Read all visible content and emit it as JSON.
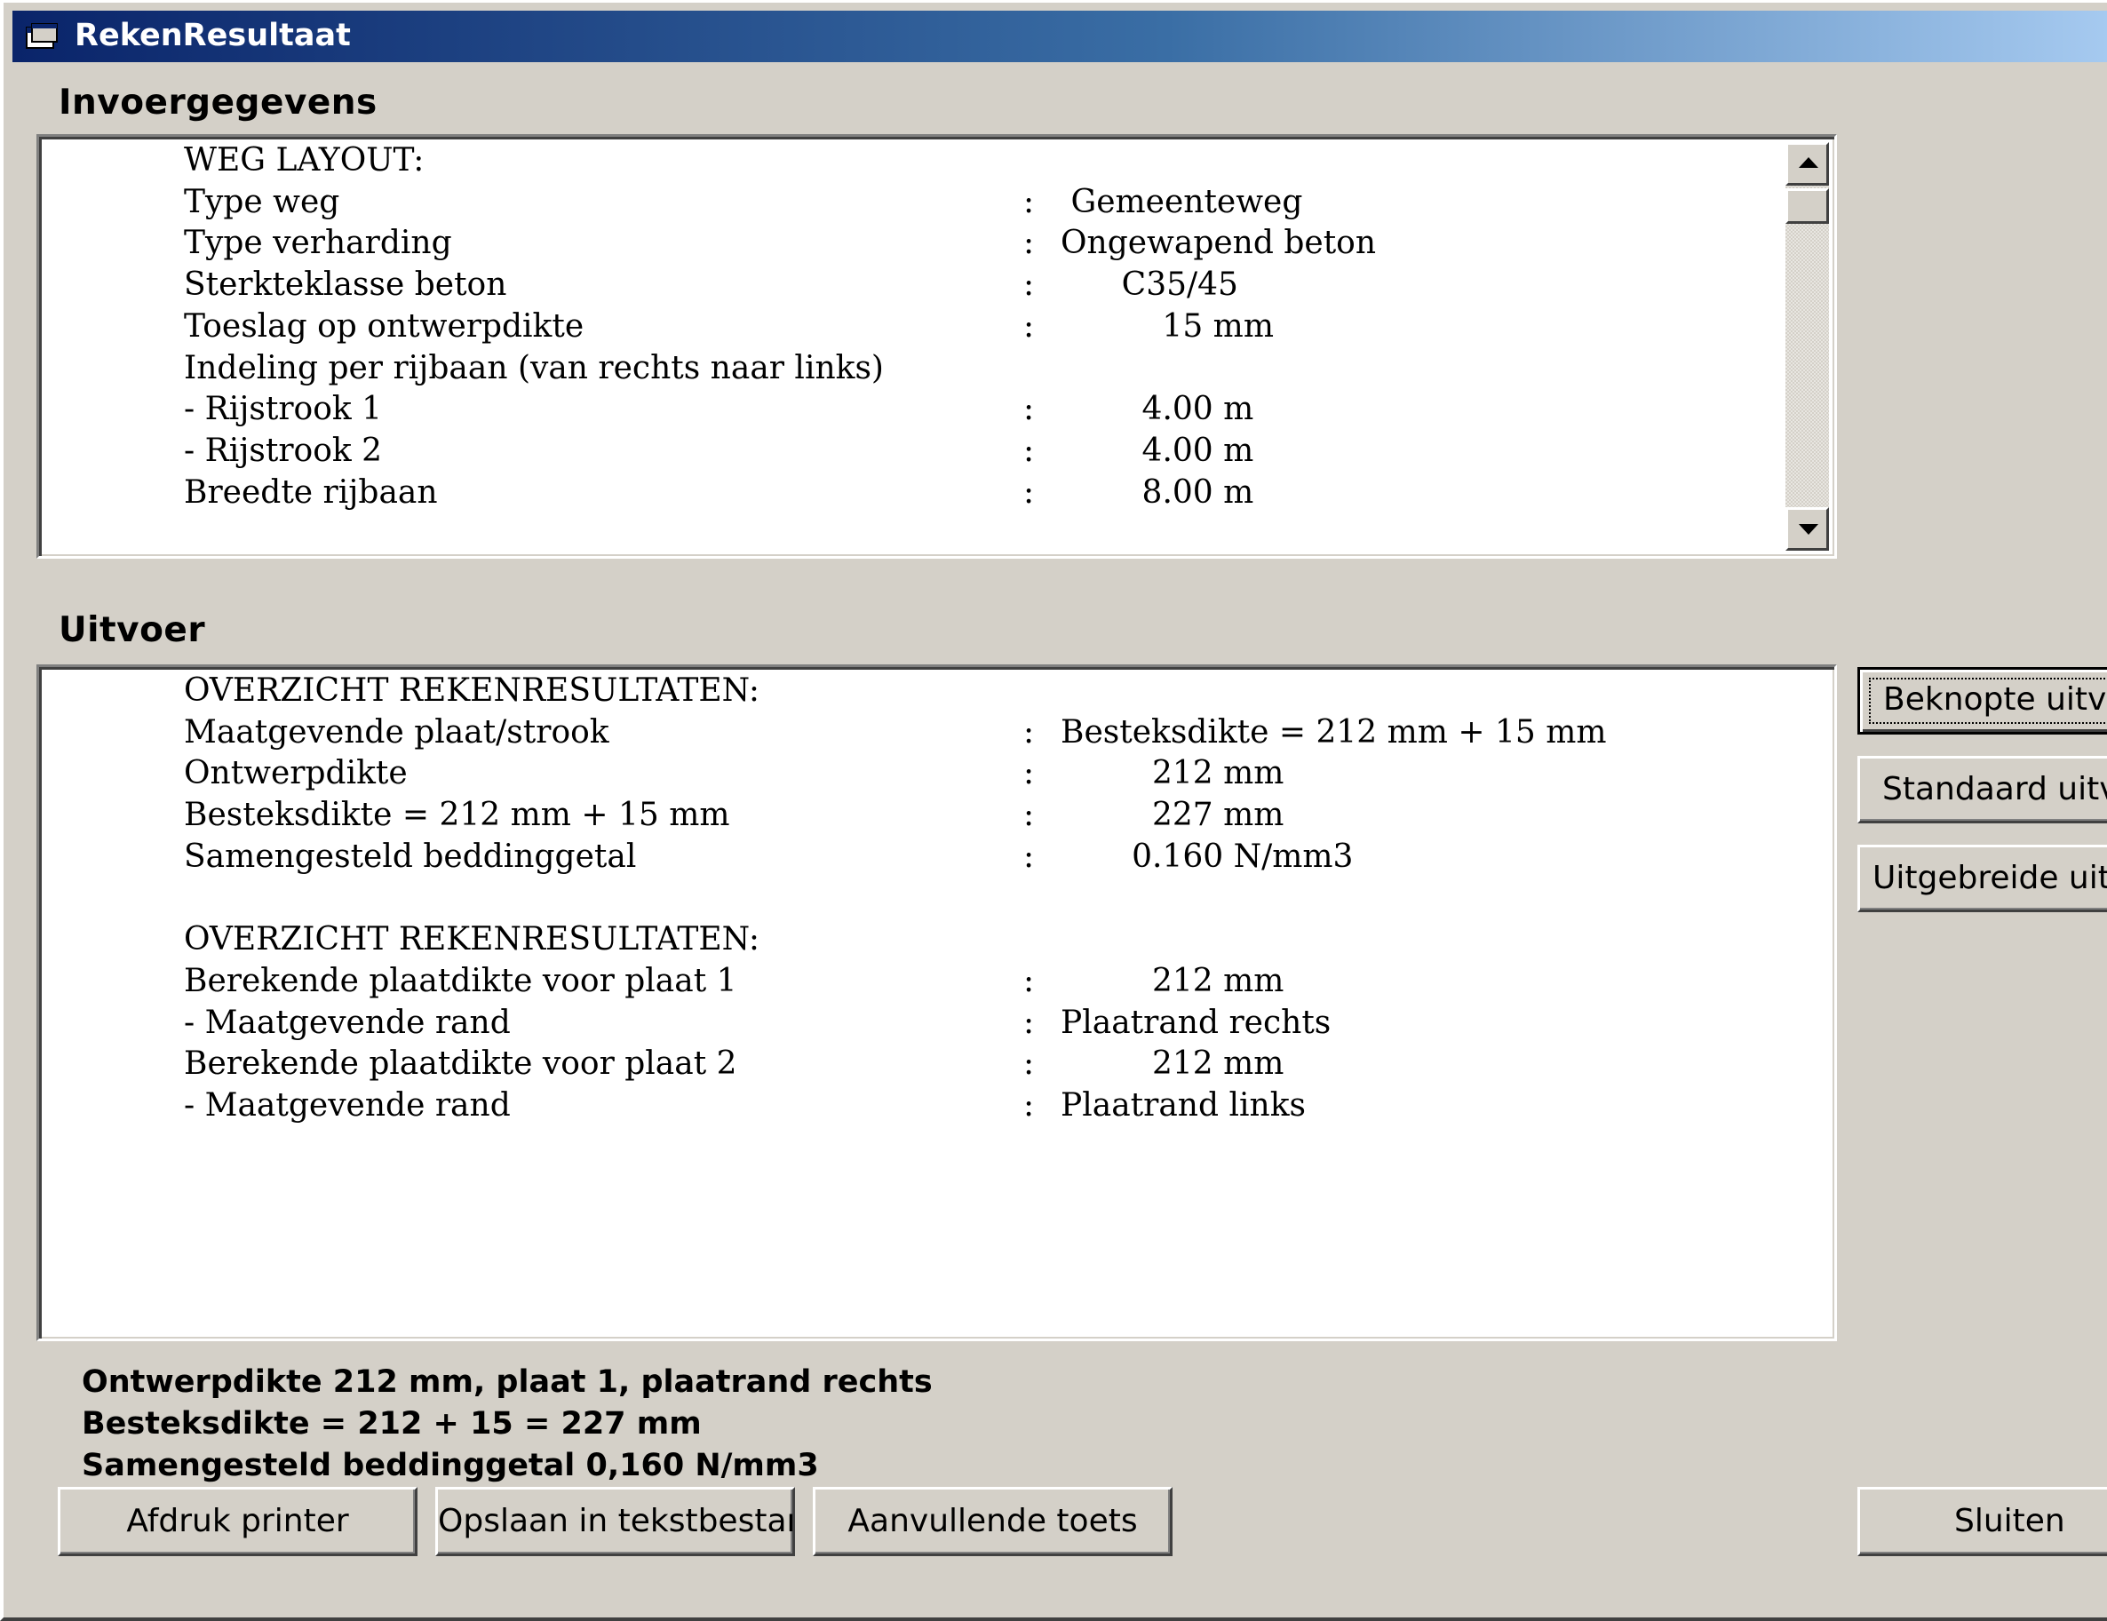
{
  "window": {
    "title": "RekenResultaat"
  },
  "invoer": {
    "label": "Invoergegevens",
    "lines": [
      {
        "text": "WEG LAYOUT:",
        "sep": "",
        "value": ""
      },
      {
        "text": "Type weg",
        "sep": ":",
        "value": " Gemeenteweg"
      },
      {
        "text": "Type verharding",
        "sep": ":",
        "value": "Ongewapend beton"
      },
      {
        "text": "Sterkteklasse beton",
        "sep": ":",
        "value": "      C35/45"
      },
      {
        "text": "Toeslag op ontwerpdikte",
        "sep": ":",
        "value": "          15 mm"
      },
      {
        "text": "Indeling per rijbaan (van rechts naar links)",
        "sep": "",
        "value": ""
      },
      {
        "text": "- Rijstrook 1",
        "sep": ":",
        "value": "        4.00 m"
      },
      {
        "text": "- Rijstrook 2",
        "sep": ":",
        "value": "        4.00 m"
      },
      {
        "text": "Breedte rijbaan",
        "sep": ":",
        "value": "        8.00 m"
      }
    ]
  },
  "uitvoer": {
    "label": "Uitvoer",
    "lines": [
      {
        "text": "OVERZICHT REKENRESULTATEN:",
        "sep": "",
        "value": ""
      },
      {
        "text": "Maatgevende plaat/strook",
        "sep": ":",
        "value": "Besteksdikte = 212 mm + 15 mm"
      },
      {
        "text": "Ontwerpdikte",
        "sep": ":",
        "value": "         212 mm"
      },
      {
        "text": "Besteksdikte = 212 mm + 15 mm",
        "sep": ":",
        "value": "         227 mm"
      },
      {
        "text": "Samengesteld beddinggetal",
        "sep": ":",
        "value": "       0.160 N/mm3"
      },
      {
        "text": "",
        "sep": "",
        "value": ""
      },
      {
        "text": "OVERZICHT REKENRESULTATEN:",
        "sep": "",
        "value": ""
      },
      {
        "text": "Berekende plaatdikte voor plaat 1",
        "sep": ":",
        "value": "         212 mm"
      },
      {
        "text": "- Maatgevende rand",
        "sep": ":",
        "value": "Plaatrand rechts"
      },
      {
        "text": "Berekende plaatdikte voor plaat 2",
        "sep": ":",
        "value": "         212 mm"
      },
      {
        "text": "- Maatgevende rand",
        "sep": ":",
        "value": "Plaatrand links"
      }
    ]
  },
  "output_buttons": {
    "beknopt": "Beknopte uitvoer",
    "standaard": "Standaard uitvoer",
    "uitgebreid": "Uitgebreide uitvoer"
  },
  "summary": {
    "line1": "Ontwerpdikte 212 mm, plaat 1, plaatrand rechts",
    "line2": "Besteksdikte = 212 + 15 = 227 mm",
    "line3": "Samengesteld beddinggetal 0,160 N/mm3"
  },
  "bottom_buttons": {
    "afdruk": "Afdruk printer",
    "opslaan": "Opslaan in tekstbestand",
    "aanvullend": "Aanvullende toets",
    "sluiten": "Sluiten"
  },
  "colors": {
    "titlebar_start": "#0a246a",
    "titlebar_end": "#a6caf0",
    "face": "#d4d0c8"
  },
  "icons": {
    "app": "app-window-icon"
  }
}
